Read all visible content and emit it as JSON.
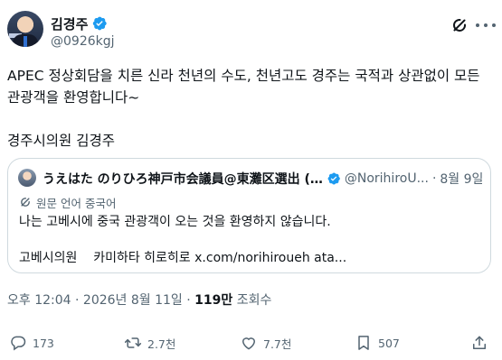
{
  "post": {
    "author_name": "김경주",
    "author_handle": "@0926kgj",
    "text": "APEC 정상회담을 치른 신라 천년의 수도, 천년고도 경주는 국적과 상관없이 모든\n관광객을 환영합니다~\n\n경주시의원 김경주",
    "timestamp": "오후 12:04 · 2026년 8월 11일 · ",
    "views_count": "119만",
    "views_label": " 조회수"
  },
  "quote": {
    "author_name": "うえはた のりひろ神戸市会議員@東灘区選出 (…",
    "author_handle": "@NorihiroU...",
    "date": "8월 9일",
    "separator": "·",
    "translate_label": "원문 언어 중국어",
    "text_line1": "나는 고베시에 중국 관광객이 오는 것을 환영하지 않습니다.",
    "text_line3_prefix": "고베시의원    카미하타 히로히로 ",
    "text_link": "x.com/norihiroueh ata..."
  },
  "actions": {
    "reply_count": "173",
    "retweet_count": "2.7천",
    "like_count": "7.7천",
    "bookmark_count": "507"
  },
  "icons": {
    "verified": "verified-badge-icon",
    "grok": "grok-icon",
    "more": "more-icon",
    "reply": "reply-icon",
    "retweet": "retweet-icon",
    "like": "heart-icon",
    "bookmark": "bookmark-icon",
    "share": "share-icon",
    "translate": "translate-icon"
  },
  "colors": {
    "verified": "#1d9bf0",
    "text": "#0f1419",
    "muted": "#536471",
    "border": "#cfd9de"
  }
}
